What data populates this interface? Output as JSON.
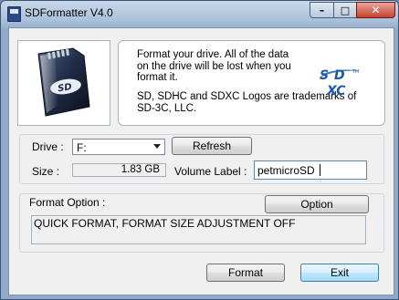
{
  "window": {
    "title": "SDFormatter V4.0",
    "controls": {
      "minimize": "–",
      "maximize": "□",
      "close": "✕"
    }
  },
  "info": {
    "line1": "Format your drive. All of the data\non the drive will be lost when you\nformat it.",
    "line2": "SD, SDHC and SDXC Logos are trademarks of\nSD-3C, LLC.",
    "logo_text": "SD XC"
  },
  "drive": {
    "label": "Drive :",
    "selected": "F:",
    "refresh_button": "Refresh"
  },
  "size": {
    "label": "Size  :",
    "value": "1.83  GB"
  },
  "volume": {
    "label": "Volume Label :",
    "value": "petmicroSD"
  },
  "format_option": {
    "label": "Format Option :",
    "option_button": "Option",
    "value": "QUICK FORMAT, FORMAT SIZE ADJUSTMENT OFF"
  },
  "actions": {
    "format_button": "Format",
    "exit_button": "Exit"
  },
  "colors": {
    "sd_logo_blue": "#1b5aa6",
    "card_dark": "#1e2a44"
  },
  "icons": [
    "app-icon",
    "sd-card-icon",
    "sdxc-logo",
    "chevron-down-icon"
  ]
}
